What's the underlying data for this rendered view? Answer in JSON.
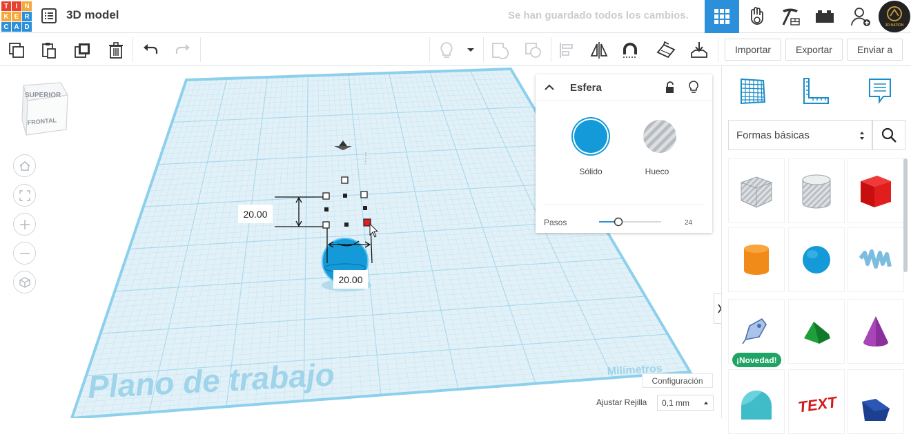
{
  "header": {
    "logo_letters": [
      "T",
      "I",
      "N",
      "K",
      "E",
      "R",
      "C",
      "A",
      "D"
    ],
    "logo_colors": [
      "#e8412b",
      "#e8412b",
      "#f4a73a",
      "#f4a73a",
      "#f4a73a",
      "#2b8fd9",
      "#2b8fd9",
      "#2b8fd9",
      "#2b8fd9"
    ],
    "title": "3D model",
    "save_status": "Se han guardado todos los cambios.",
    "avatar_caption": "3D NATION",
    "accent_color": "#2b8fd9"
  },
  "toolbar": {
    "import_label": "Importar",
    "export_label": "Exportar",
    "send_label": "Enviar a"
  },
  "viewcube": {
    "top_label": "SUPERIOR",
    "front_label": "FRONTAL"
  },
  "workplane": {
    "watermark": "Plano de trabajo",
    "units": "Milímetros"
  },
  "dimensions": {
    "height_value": "20.00",
    "width_value": "20.00"
  },
  "shape_panel": {
    "title": "Esfera",
    "solid_label": "Sólido",
    "hole_label": "Hueco",
    "solid_color": "#149ad8",
    "steps_label": "Pasos",
    "steps_value": "24"
  },
  "grid_settings": {
    "config_label": "Configuración",
    "snap_label": "Ajustar Rejilla",
    "snap_value": "0,1 mm"
  },
  "library": {
    "selected": "Formas básicas",
    "new_badge": "¡Novedad!",
    "shapes": [
      "box-hole",
      "cylinder-hole",
      "box",
      "cylinder",
      "sphere",
      "scribble",
      "shape-generator",
      "roof",
      "cone",
      "round-roof",
      "text",
      "wedge"
    ]
  }
}
